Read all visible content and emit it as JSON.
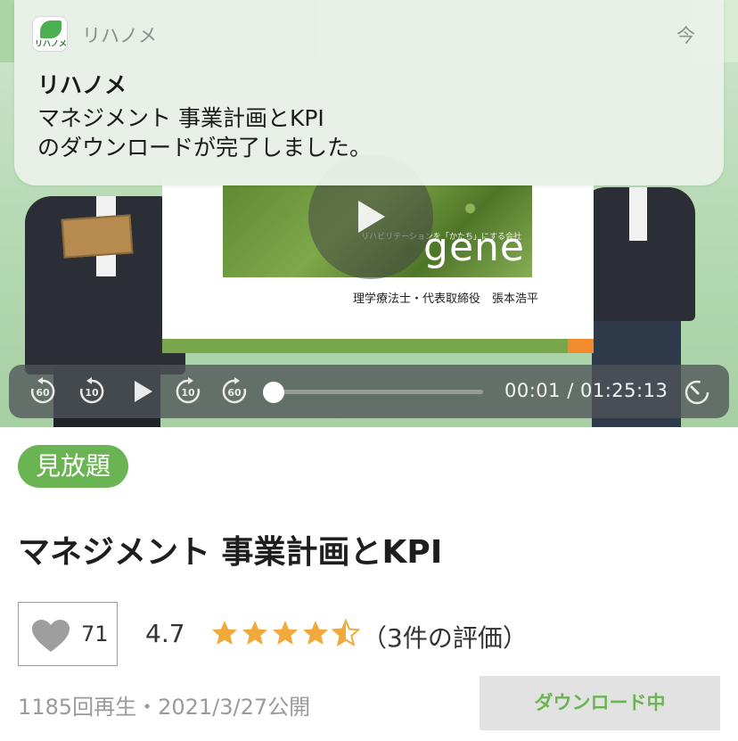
{
  "notification": {
    "app_name": "リハノメ",
    "time": "今",
    "icon": "rihanome-app-icon",
    "icon_text": "リハノメ",
    "title": "リハノメ",
    "body_line1": "マネジメント 事業計画とKPI",
    "body_line2": "のダウンロードが完了しました。"
  },
  "video": {
    "slide_caption": "理学療法士・代表取締役　張本浩平",
    "slide_logo": "gene",
    "slide_tagline": "リハビリテーションを「かたち」にする会社",
    "current_time": "00:01",
    "total_time": "01:25:13",
    "progress": 0.0,
    "controls": {
      "rewind60": "60",
      "rewind10": "10",
      "forward10": "10",
      "forward60": "60"
    }
  },
  "details": {
    "badge": "見放題",
    "title": "マネジメント 事業計画とKPI",
    "likes": "71",
    "rating": "4.7",
    "rating_value": 4.7,
    "reviews": "（3件の評価）",
    "meta": "1185回再生・2021/3/27公開",
    "download_label": "ダウンロード中"
  },
  "colors": {
    "accent": "#6bb453",
    "star": "#f2a93b",
    "controls_bg": "#50545a"
  }
}
